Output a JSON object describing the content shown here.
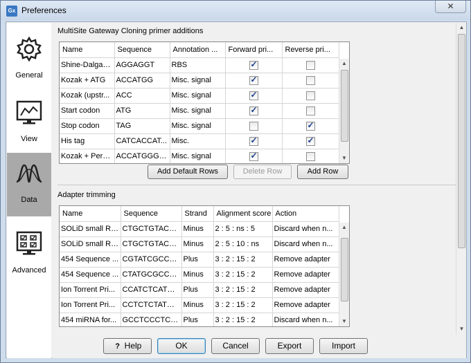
{
  "window": {
    "title": "Preferences",
    "app_icon_text": "Gx",
    "close_glyph": "✕"
  },
  "sidebar": {
    "items": [
      {
        "label": "General",
        "icon": "gear-icon",
        "selected": false
      },
      {
        "label": "View",
        "icon": "monitor-chart-icon",
        "selected": false
      },
      {
        "label": "Data",
        "icon": "waveform-icon",
        "selected": true
      },
      {
        "label": "Advanced",
        "icon": "checklist-icon",
        "selected": false
      }
    ]
  },
  "primer_section": {
    "title": "MultiSite Gateway Cloning primer additions",
    "columns": [
      "Name",
      "Sequence",
      "Annotation ...",
      "Forward pri...",
      "Reverse pri..."
    ],
    "rows": [
      {
        "name": "Shine-Dalgarno",
        "sequence": "AGGAGGT",
        "annotation": "RBS",
        "forward": true,
        "reverse": false
      },
      {
        "name": "Kozak + ATG",
        "sequence": "ACCATGG",
        "annotation": "Misc. signal",
        "forward": true,
        "reverse": false
      },
      {
        "name": "Kozak (upstr...",
        "sequence": "ACC",
        "annotation": "Misc. signal",
        "forward": true,
        "reverse": false
      },
      {
        "name": "Start codon",
        "sequence": "ATG",
        "annotation": "Misc. signal",
        "forward": true,
        "reverse": false
      },
      {
        "name": "Stop codon",
        "sequence": "TAG",
        "annotation": "Misc. signal",
        "forward": false,
        "reverse": true
      },
      {
        "name": "His tag",
        "sequence": "CATCACCAT...",
        "annotation": "Misc.",
        "forward": true,
        "reverse": true
      },
      {
        "name": "Kozak + Pero...",
        "sequence": "ACCATGGGC...",
        "annotation": "Misc. signal",
        "forward": true,
        "reverse": false
      }
    ],
    "buttons": {
      "add_default": "Add Default Rows",
      "delete_row": "Delete Row",
      "add_row": "Add Row"
    }
  },
  "adapter_section": {
    "title": "Adapter trimming",
    "columns": [
      "Name",
      "Sequence",
      "Strand",
      "Alignment score",
      "Action"
    ],
    "rows": [
      {
        "name": "SOLiD small RN...",
        "sequence": "CTGCTGTACGG...",
        "strand": "Minus",
        "score": "2 : 5 : ns : 5",
        "action": "Discard when n..."
      },
      {
        "name": "SOLiD small RN...",
        "sequence": "CTGCTGTACGG...",
        "strand": "Minus",
        "score": "2 : 5 : 10 : ns",
        "action": "Discard when n..."
      },
      {
        "name": "454 Sequence ...",
        "sequence": "CGTATCGCCTC...",
        "strand": "Plus",
        "score": "3 : 2 : 15 : 2",
        "action": "Remove adapter"
      },
      {
        "name": "454 Sequence ...",
        "sequence": "CTATGCGCCTT...",
        "strand": "Minus",
        "score": "3 : 2 : 15 : 2",
        "action": "Remove adapter"
      },
      {
        "name": "Ion Torrent Pri...",
        "sequence": "CCATCTCATCC...",
        "strand": "Plus",
        "score": "3 : 2 : 15 : 2",
        "action": "Remove adapter"
      },
      {
        "name": "Ion Torrent Pri...",
        "sequence": "CCTCTCTATGG...",
        "strand": "Minus",
        "score": "3 : 2 : 15 : 2",
        "action": "Remove adapter"
      },
      {
        "name": "454 miRNA for...",
        "sequence": "GCCTCCCTCG...",
        "strand": "Plus",
        "score": "3 : 2 : 15 : 2",
        "action": "Discard when n..."
      }
    ]
  },
  "footer": {
    "help": "Help",
    "help_glyph": "?",
    "ok": "OK",
    "cancel": "Cancel",
    "export": "Export",
    "import": "Import"
  }
}
